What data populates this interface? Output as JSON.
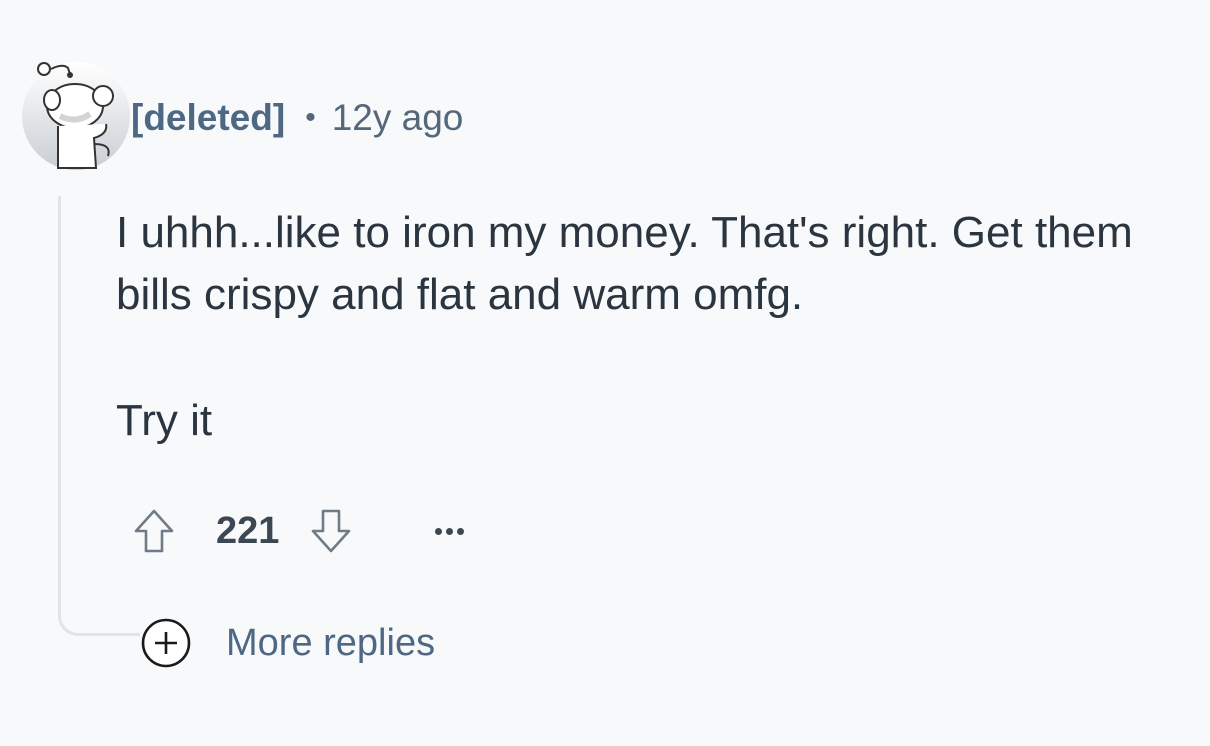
{
  "comment": {
    "author": "[deleted]",
    "separator": "•",
    "time": "12y ago",
    "body_lines": [
      "I uhhh...like to iron my money. That's right. Get them bills crispy and flat and warm omfg.",
      "Try it"
    ],
    "score": "221"
  },
  "actions": {
    "upvote_icon": "upvote-arrow-icon",
    "downvote_icon": "downvote-arrow-icon",
    "overflow_icon": "ellipsis-icon"
  },
  "replies": {
    "more_label": "More replies",
    "icon": "plus-circle-icon"
  }
}
